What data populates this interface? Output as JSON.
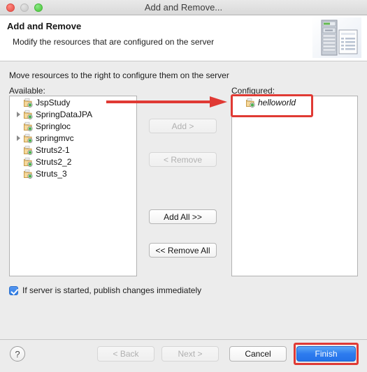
{
  "window": {
    "title": "Add and Remove...",
    "controls": {
      "close": "close",
      "minimize": "minimize",
      "maximize": "maximize"
    }
  },
  "banner": {
    "title": "Add and Remove",
    "subtitle": "Modify the resources that are configured on the server",
    "icon": "server-document-icon"
  },
  "main": {
    "instruction": "Move resources to the right to configure them on the server",
    "available_label": "Available:",
    "configured_label": "Configured:",
    "available_items": [
      {
        "label": "JspStudy",
        "expandable": false,
        "italic": false
      },
      {
        "label": "SpringDataJPA",
        "expandable": true,
        "italic": false
      },
      {
        "label": "Springloc",
        "expandable": false,
        "italic": false
      },
      {
        "label": "springmvc",
        "expandable": true,
        "italic": false
      },
      {
        "label": "Struts2-1",
        "expandable": false,
        "italic": false
      },
      {
        "label": "Struts2_2",
        "expandable": false,
        "italic": false
      },
      {
        "label": "Struts_3",
        "expandable": false,
        "italic": false
      }
    ],
    "configured_items": [
      {
        "label": "helloworld",
        "expandable": false,
        "italic": true
      }
    ],
    "buttons": {
      "add": "Add >",
      "remove": "< Remove",
      "add_all": "Add All >>",
      "remove_all": "<< Remove All"
    },
    "buttons_enabled": {
      "add": false,
      "remove": false,
      "add_all": true,
      "remove_all": true
    },
    "checkbox": {
      "label": "If server is started, publish changes immediately",
      "checked": true
    }
  },
  "footer": {
    "help": "?",
    "back": "< Back",
    "next": "Next >",
    "cancel": "Cancel",
    "finish": "Finish",
    "back_enabled": false,
    "next_enabled": false
  },
  "annotations": {
    "highlight_color": "#e03a34",
    "arrow": "points from available list toward configured list",
    "highlighted": [
      "configured-helloworld",
      "finish-button"
    ]
  },
  "colors": {
    "accent_blue": "#2d7cef",
    "highlight_red": "#e03a34",
    "window_bg": "#ececec",
    "panel_bg": "#ffffff"
  }
}
